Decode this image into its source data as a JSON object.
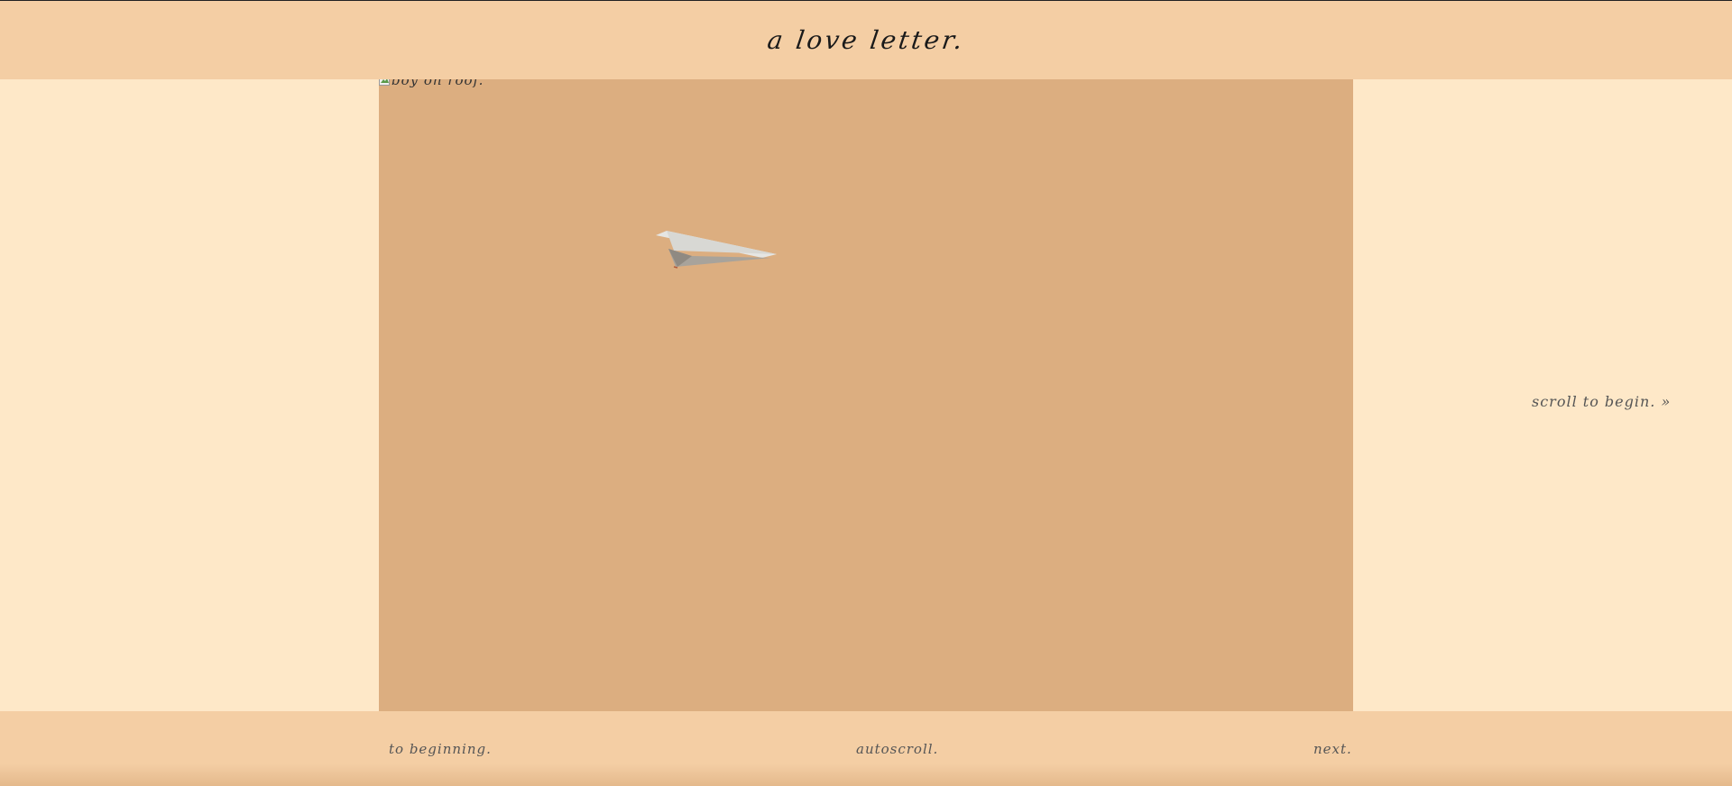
{
  "header": {
    "title": "a love letter."
  },
  "stage": {
    "image_alt": "boy on roof.",
    "image_icon": "broken-image-icon",
    "plane_icon": "paper-plane-icon",
    "colors": {
      "stage_bg": "#dcae80",
      "plane_light": "#e4e4e2",
      "plane_shadow": "#a8a39b"
    }
  },
  "hint": {
    "text": "scroll to begin. »"
  },
  "footer": {
    "to_beginning": "to beginning.",
    "autoscroll": "autoscroll.",
    "next": "next."
  },
  "colors": {
    "page_bg": "#fee8c8",
    "bar_bg": "#f4cea4"
  }
}
